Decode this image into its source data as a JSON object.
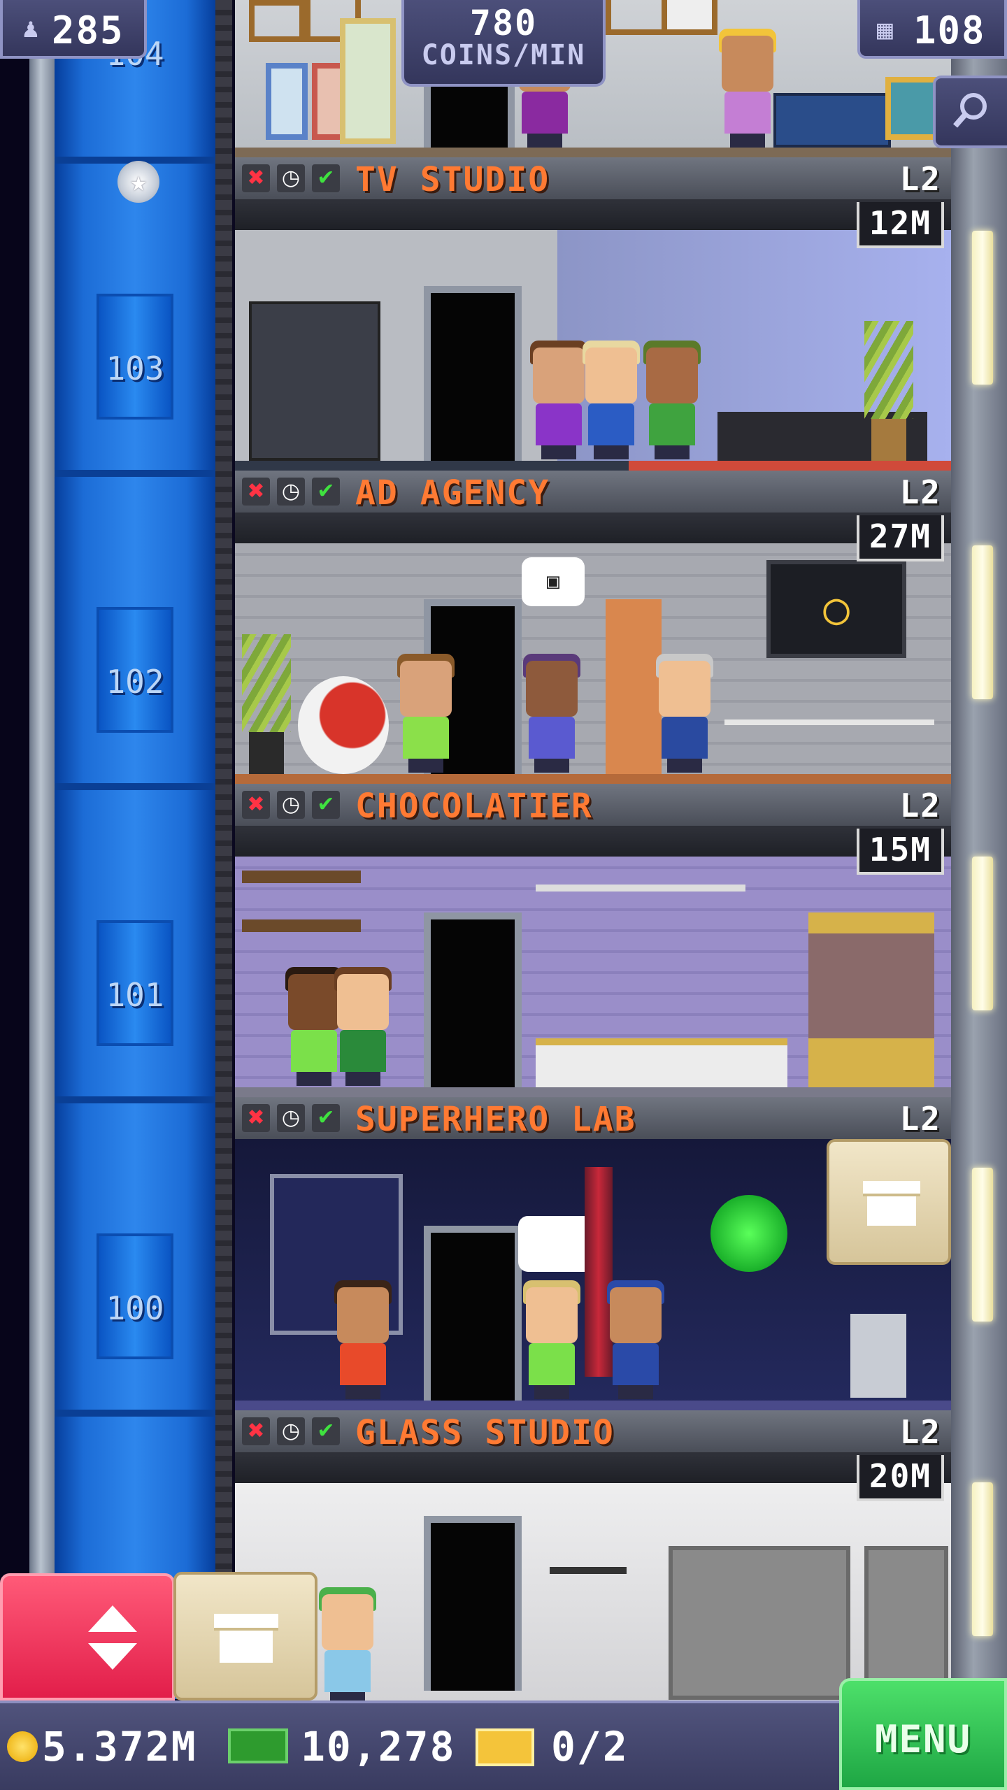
{
  "hud": {
    "population": "285",
    "income_value": "780",
    "income_unit": "COINS/MIN",
    "floor_count": "108",
    "population_icon": "person-icon",
    "floors_icon": "building-icon",
    "search_icon": "magnifier-icon"
  },
  "shaft": {
    "floor_numbers": [
      "104",
      "103",
      "102",
      "101",
      "100"
    ]
  },
  "floors": [
    {
      "name": "TV STUDIO",
      "level": "L2",
      "stock": "12M",
      "room_color": "#8c95c6"
    },
    {
      "name": "AD AGENCY",
      "level": "L2",
      "stock": "27M",
      "room_color": "#a7a9b0"
    },
    {
      "name": "CHOCOLATIER",
      "level": "L2",
      "stock": "15M",
      "room_color": "#9a8ec9"
    },
    {
      "name": "SUPERHERO LAB",
      "level": "L2",
      "stock": "",
      "room_color": "#1b1f4a"
    },
    {
      "name": "GLASS STUDIO",
      "level": "L2",
      "stock": "20M",
      "room_color": "#d8d8dc"
    }
  ],
  "bottom": {
    "coins": "5.372M",
    "bux": "10,278",
    "tickets": "0/2",
    "menu_label": "MENU"
  },
  "colors": {
    "accent_orange": "#ff7a33",
    "elevator_blue": "#2e86ec",
    "menu_green": "#1ea644",
    "elevator_red": "#e21e4a"
  }
}
